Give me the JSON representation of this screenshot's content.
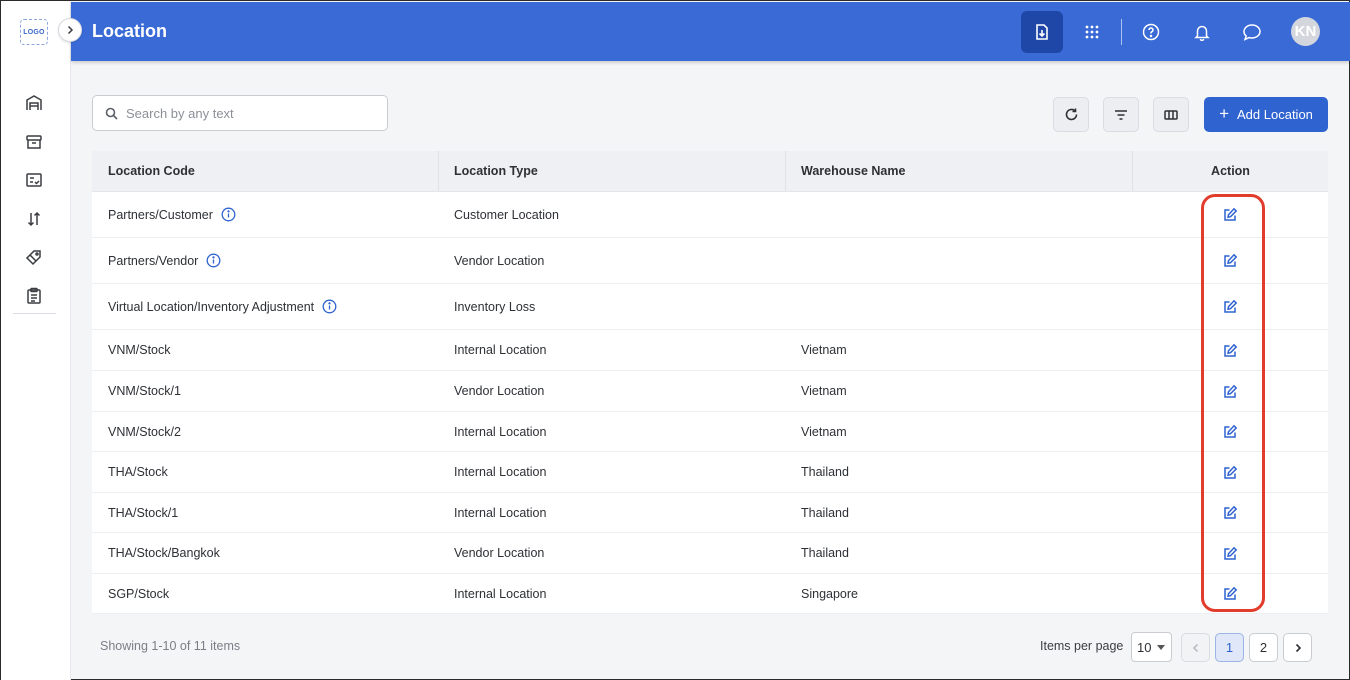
{
  "sidebar": {
    "logo_text": "LOGO",
    "icons": [
      "warehouse-icon",
      "archive-icon",
      "checklist-icon",
      "sort-arrows-icon",
      "tags-icon",
      "clipboard-icon"
    ]
  },
  "header": {
    "title": "Location",
    "avatar_initials": "KN"
  },
  "toolbar": {
    "search_placeholder": "Search by any text",
    "add_label": "Add Location"
  },
  "table": {
    "columns": [
      "Location Code",
      "Location Type",
      "Warehouse Name",
      "Action"
    ],
    "rows": [
      {
        "code": "Partners/Customer",
        "type": "Customer Location",
        "warehouse": "",
        "info": true
      },
      {
        "code": "Partners/Vendor",
        "type": "Vendor Location",
        "warehouse": "",
        "info": true
      },
      {
        "code": "Virtual Location/Inventory Adjustment",
        "type": "Inventory Loss",
        "warehouse": "",
        "info": true
      },
      {
        "code": "VNM/Stock",
        "type": "Internal Location",
        "warehouse": "Vietnam",
        "info": false
      },
      {
        "code": "VNM/Stock/1",
        "type": "Vendor Location",
        "warehouse": "Vietnam",
        "info": false
      },
      {
        "code": "VNM/Stock/2",
        "type": "Internal Location",
        "warehouse": "Vietnam",
        "info": false
      },
      {
        "code": "THA/Stock",
        "type": "Internal Location",
        "warehouse": "Thailand",
        "info": false
      },
      {
        "code": "THA/Stock/1",
        "type": "Internal Location",
        "warehouse": "Thailand",
        "info": false
      },
      {
        "code": "THA/Stock/Bangkok",
        "type": "Vendor Location",
        "warehouse": "Thailand",
        "info": false
      },
      {
        "code": "SGP/Stock",
        "type": "Internal Location",
        "warehouse": "Singapore",
        "info": false
      }
    ]
  },
  "footer": {
    "showing_text": "Showing 1-10 of 11 items",
    "items_per_page_label": "Items per page",
    "items_per_page_value": "10",
    "pages": [
      "1",
      "2"
    ],
    "current_page": "1"
  },
  "colors": {
    "header_bg": "#3a6ad6",
    "accent": "#2f63d0",
    "highlight": "#e23c2c"
  }
}
